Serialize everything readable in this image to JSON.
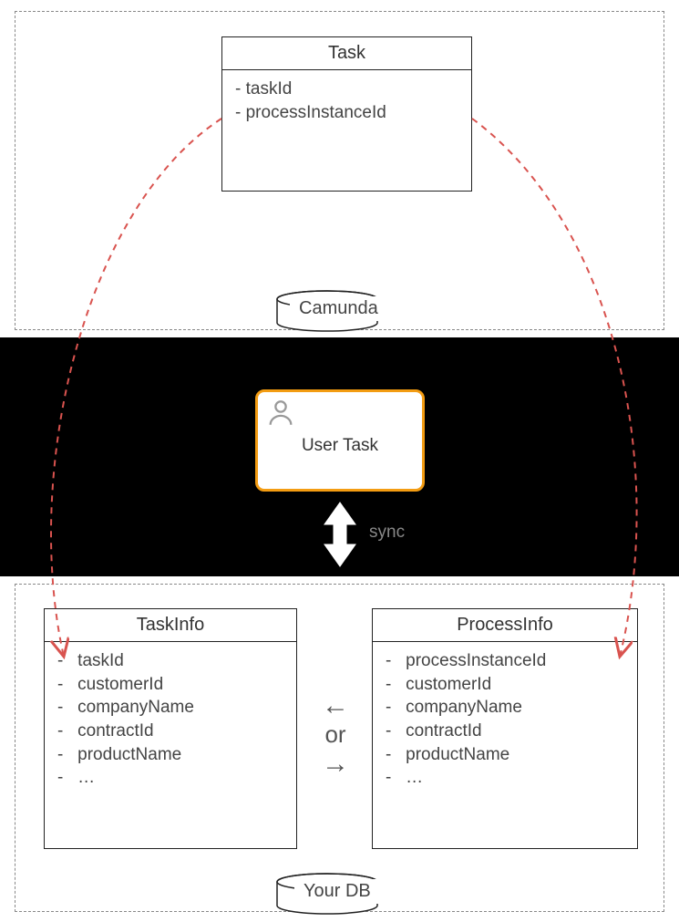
{
  "camunda": {
    "label": "Camunda",
    "taskClass": {
      "title": "Task",
      "fields": [
        "- taskId",
        "- processInstanceId"
      ]
    }
  },
  "middle": {
    "userTaskLabel": "User Task",
    "syncLabel": "sync"
  },
  "yourdb": {
    "label": "Your DB",
    "taskInfo": {
      "title": "TaskInfo",
      "fields": [
        "-   taskId",
        "",
        "-   customerId",
        "-   companyName",
        "-   contractId",
        "-   productName",
        "-   …"
      ]
    },
    "processInfo": {
      "title": "ProcessInfo",
      "fields": [
        "-   processInstanceId",
        "",
        "-   customerId",
        "-   companyName",
        "-   contractId",
        "-   productName",
        "-   …"
      ]
    },
    "orText": "or",
    "arrowLeft": "←",
    "arrowRight": "→"
  }
}
